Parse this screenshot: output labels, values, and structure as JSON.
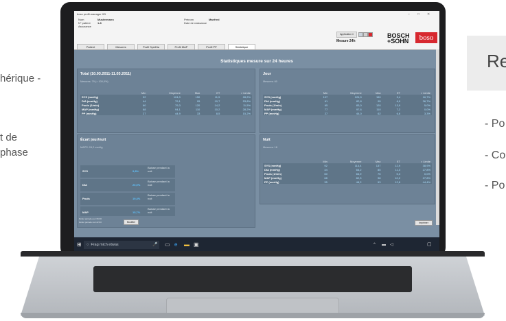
{
  "left_text": {
    "line1": "hérique -",
    "line2": "t de",
    "line3": "phase"
  },
  "right_text": {
    "title": "Re",
    "bullets": [
      "- Po",
      "- Co",
      "- Po"
    ]
  },
  "app": {
    "title": "boso profil-manager XD",
    "header": {
      "nom_label": "Nom",
      "nom_value": "Mustermann",
      "patient_label": "N° patient",
      "patient_value": "1-8",
      "assurance_label": "Assurance",
      "prenom_label": "Prénom",
      "prenom_value": "Manfred",
      "naissance_label": "Date de naissance"
    },
    "application_button": "Application ▾",
    "mode_label": "Mesure 24h",
    "logo_bosch": "BOSCH",
    "logo_sohn": "+SOHN",
    "logo_boso": "boso"
  },
  "tabs": [
    "Patient",
    "Mesures",
    "Profil Sys/Dia",
    "Profil MAP",
    "Profil PP",
    "Statistique"
  ],
  "active_tab": "Statistique",
  "stats_title": "Statistiques mesure sur 24 heures",
  "columns": [
    "Min",
    "Moyenne",
    "Max",
    "ET",
    "> Limite"
  ],
  "total": {
    "title": "Total (10.03.2011-11.03.2011)",
    "sub": "Mesures: 79 (= 100,0%)",
    "rows": [
      {
        "label": "SYS (mmHg)",
        "vals": [
          "92",
          "124,0",
          "150",
          "11,5",
          "28,2%"
        ]
      },
      {
        "label": "DIA (mmHg)",
        "vals": [
          "44",
          "79,1",
          "95",
          "10,7",
          "53,8%"
        ]
      },
      {
        "label": "Pouls (1/min)",
        "vals": [
          "60",
          "79,3",
          "120",
          "14,2",
          "11,5%"
        ]
      },
      {
        "label": "MAP (mmHg)",
        "vals": [
          "68",
          "94,1",
          "110",
          "10,2",
          "28,2%"
        ]
      },
      {
        "label": "PP (mmHg)",
        "vals": [
          "27",
          "44,9",
          "33",
          "8,5",
          "15,2%"
        ]
      }
    ]
  },
  "jour": {
    "title": "Jour",
    "sub": "Mesures: 60",
    "rows": [
      {
        "label": "SYS (mmHg)",
        "vals": [
          "107",
          "126,9",
          "150",
          "9,4",
          "16,7%"
        ]
      },
      {
        "label": "DIA (mmHg)",
        "vals": [
          "61",
          "82,8",
          "95",
          "6,9",
          "36,7%"
        ]
      },
      {
        "label": "Pouls (1/min)",
        "vals": [
          "65",
          "83,0",
          "120",
          "13,9",
          "5,0%"
        ]
      },
      {
        "label": "MAP (mmHg)",
        "vals": [
          "77",
          "97,6",
          "110",
          "7,2",
          "0,0%"
        ]
      },
      {
        "label": "PP (mmHg)",
        "vals": [
          "27",
          "44,0",
          "62",
          "6,6",
          "3,3%"
        ]
      }
    ]
  },
  "nuit": {
    "title": "Nuit",
    "sub": "Mesures: 18",
    "rows": [
      {
        "label": "SYS (mmHg)",
        "vals": [
          "92",
          "114,4",
          "137",
          "12,9",
          "38,9%"
        ]
      },
      {
        "label": "DIA (mmHg)",
        "vals": [
          "44",
          "66,2",
          "85",
          "11,3",
          "27,8%"
        ]
      },
      {
        "label": "Pouls (1/min)",
        "vals": [
          "60",
          "66,9",
          "75",
          "5,3",
          "0,0%"
        ]
      },
      {
        "label": "MAP (mmHg)",
        "vals": [
          "68",
          "82,3",
          "98",
          "10,2",
          "27,8%"
        ]
      },
      {
        "label": "PP (mmHg)",
        "vals": [
          "35",
          "48,2",
          "93",
          "12,8",
          "44,4%"
        ]
      }
    ]
  },
  "ecart": {
    "title": "Écart jour/nuit",
    "sub": "MAPS: 24,2 mmHg",
    "rows": [
      {
        "label": "SYS",
        "value": "9,8%",
        "text": "Baisse pendant la nuit"
      },
      {
        "label": "DIA",
        "value": "20,0%",
        "text": "Baisse pendant la nuit"
      },
      {
        "label": "Pouls",
        "value": "19,4%",
        "text": "Baisse pendant la nuit"
      },
      {
        "label": "MAP",
        "value": "15,7%",
        "text": "Baisse pendant la nuit"
      }
    ],
    "period_day": "Début période jour   06:00",
    "period_night": "Début période nuit   22:00",
    "modify_button": "Modifier"
  },
  "print_button": "Imprimer",
  "taskbar": {
    "search_placeholder": "Frag mich etwas",
    "time": "",
    "colors": {
      "taskbar": "#1e2633",
      "panel": "#6d8296",
      "accent": "#5fc3ff",
      "brand_red": "#d7282f"
    }
  }
}
